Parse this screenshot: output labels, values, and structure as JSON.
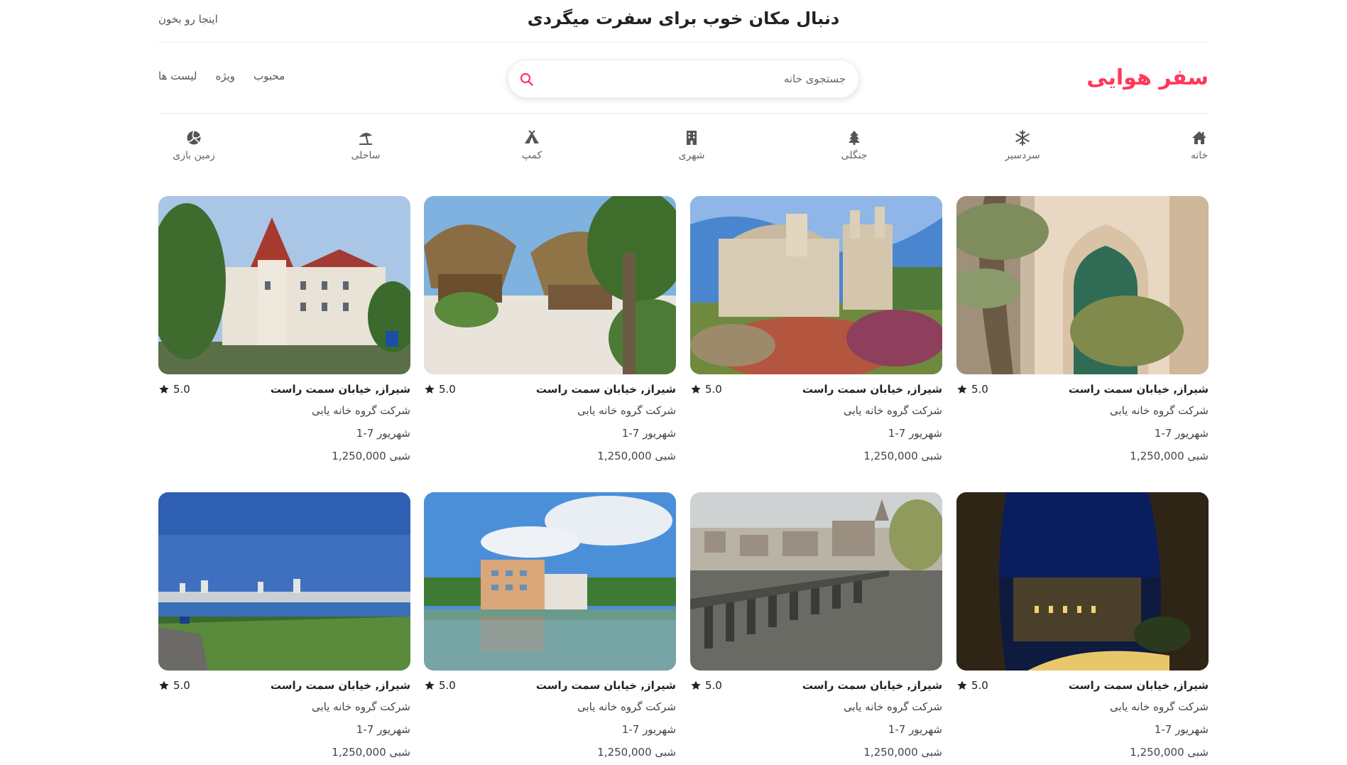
{
  "banner": {
    "title": "دنبال مکان خوب برای سفرت میگردی",
    "link": "اینجا رو بخون"
  },
  "header": {
    "logo": "سفر هوایی",
    "search_placeholder": "جستجوی خانه",
    "nav": [
      "لیست ها",
      "ویژه",
      "محبوب"
    ]
  },
  "categories": [
    {
      "label": "خانه",
      "icon": "home-icon"
    },
    {
      "label": "سردسیر",
      "icon": "snowflake-icon"
    },
    {
      "label": "جنگلی",
      "icon": "tree-icon"
    },
    {
      "label": "شهری",
      "icon": "building-icon"
    },
    {
      "label": "کمپ",
      "icon": "tent-icon"
    },
    {
      "label": "ساحلی",
      "icon": "beach-umbrella-icon"
    },
    {
      "label": "زمین بازی",
      "icon": "volleyball-icon"
    }
  ],
  "listings": [
    {
      "title": "شیراز, خیابان سمت راست",
      "rating": "5.0",
      "host": "شرکت گروه خانه یابی",
      "dates": "شهریور 7-1",
      "price": "شبی 1,250,000",
      "image": "moorish-arch-palms"
    },
    {
      "title": "شیراز, خیابان سمت راست",
      "rating": "5.0",
      "host": "شرکت گروه خانه یابی",
      "dates": "شهریور 7-1",
      "price": "شبی 1,250,000",
      "image": "ornate-palace-garden"
    },
    {
      "title": "شیراز, خیابان سمت راست",
      "rating": "5.0",
      "host": "شرکت گروه خانه یابی",
      "dates": "شهریور 7-1",
      "price": "شبی 1,250,000",
      "image": "thatched-huts-beach"
    },
    {
      "title": "شیراز, خیابان سمت راست",
      "rating": "5.0",
      "host": "شرکت گروه خانه یابی",
      "dates": "شهریور 7-1",
      "price": "شبی 1,250,000",
      "image": "lakeside-chateau"
    },
    {
      "title": "شیراز, خیابان سمت راست",
      "rating": "5.0",
      "host": "شرکت گروه خانه یابی",
      "dates": "شهریور 7-1",
      "price": "شبی 1,250,000",
      "image": "night-colonnade"
    },
    {
      "title": "شیراز, خیابان سمت راست",
      "rating": "5.0",
      "host": "شرکت گروه خانه یابی",
      "dates": "شهریور 7-1",
      "price": "شبی 1,250,000",
      "image": "river-city-pier"
    },
    {
      "title": "شیراز, خیابان سمت راست",
      "rating": "5.0",
      "host": "شرکت گروه خانه یابی",
      "dates": "شهریور 7-1",
      "price": "شبی 1,250,000",
      "image": "campus-reflection"
    },
    {
      "title": "شیراز, خیابان سمت راست",
      "rating": "5.0",
      "host": "شرکت گروه خانه یابی",
      "dates": "شهریور 7-1",
      "price": "شبی 1,250,000",
      "image": "seaside-lawn"
    }
  ],
  "colors": {
    "accent": "#ff385c",
    "text": "#222222",
    "muted": "#666666"
  }
}
